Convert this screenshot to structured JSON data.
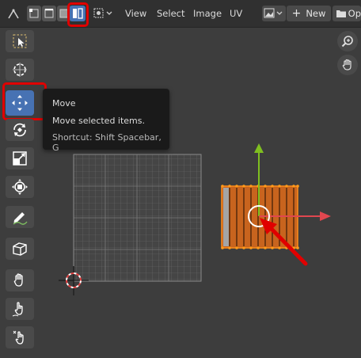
{
  "header": {
    "menus": [
      "View",
      "Select",
      "Image",
      "UV"
    ],
    "new_button_label": "New",
    "new_button_plus": "+",
    "truncated_label": "Op"
  },
  "toolbar": {
    "tools": [
      {
        "name": "select-box-tool",
        "icon": "select-box-icon"
      },
      {
        "name": "cursor-tool",
        "icon": "cursor-icon"
      },
      {
        "name": "move-tool",
        "icon": "move-icon",
        "active": true
      },
      {
        "name": "rotate-tool",
        "icon": "rotate-icon"
      },
      {
        "name": "scale-tool",
        "icon": "scale-icon"
      },
      {
        "name": "transform-tool",
        "icon": "transform-icon"
      },
      {
        "name": "annotate-tool",
        "icon": "annotate-icon"
      },
      {
        "name": "rip-region-tool",
        "icon": "rip-region-icon"
      },
      {
        "name": "grab-tool",
        "icon": "grab-icon"
      },
      {
        "name": "relax-tool",
        "icon": "relax-icon"
      },
      {
        "name": "pinch-tool",
        "icon": "pinch-icon"
      }
    ]
  },
  "tooltip": {
    "title": "Move",
    "description": "Move selected items.",
    "shortcut": "Shortcut: Shift Spacebar, G"
  },
  "colors": {
    "accent_active": "#4772b3",
    "annotation_red": "#e00000",
    "uv_orange": "#c8641e",
    "gizmo_green": "#7fbf20",
    "gizmo_red": "#e0474f"
  }
}
